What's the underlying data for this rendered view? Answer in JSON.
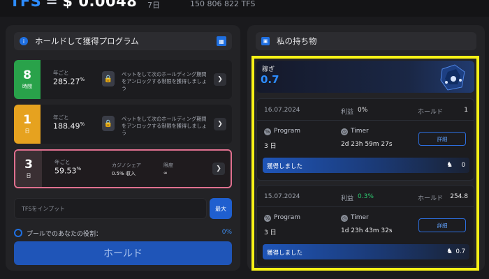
{
  "top": {
    "tfs_label": "TFS",
    "eq": "=",
    "price": "$ 0.0048",
    "period": "7日",
    "supply": "150 806 822 TFS"
  },
  "left": {
    "header_title": "ホールドして獲得プログラム",
    "programs": [
      {
        "duration_num": "8",
        "duration_unit": "時間",
        "per_label": "年ごと",
        "rate": "285.27",
        "rate_unit": "%",
        "lock_text": "ペットをして次のホールディング期間をアンロックする制限を獲得しましょう",
        "badge_color": "#29a24a"
      },
      {
        "duration_num": "1",
        "duration_unit": "日",
        "per_label": "年ごと",
        "rate": "188.49",
        "rate_unit": "%",
        "lock_text": "ペットをして次のホールディング期間をアンロックする制限を獲得しましょう",
        "badge_color": "#e6a21f"
      },
      {
        "duration_num": "3",
        "duration_unit": "日",
        "per_label": "年ごと",
        "rate": "59.53",
        "rate_unit": "%",
        "casino_label": "カジノシェア",
        "casino_value": "0.5% 収入",
        "limit_label": "限度",
        "limit_value": "∞",
        "badge_color": "#3a2f33",
        "border_color": "#e0708f"
      }
    ],
    "input_placeholder": "TFSをインプット",
    "max_label": "最大",
    "share_label": "プールでのあなたの役割：",
    "share_value": "0%",
    "hold_button": "ホールド"
  },
  "right": {
    "header_title": "私の持ち物",
    "earn_title": "稼ぎ",
    "earn_value": "0.7",
    "holdings": [
      {
        "date": "16.07.2024",
        "profit_label": "利益",
        "profit_value": "0%",
        "hold_label": "ホールド",
        "hold_value": "1",
        "program_label": "Program",
        "program_value": "3 日",
        "timer_label": "Timer",
        "timer_value": "2d 23h 59m 27s",
        "detail_label": "詳細",
        "earned_label": "獲得しました",
        "earned_value": "0"
      },
      {
        "date": "15.07.2024",
        "profit_label": "利益",
        "profit_value": "0.3%",
        "hold_label": "ホールド",
        "hold_value": "254.8",
        "program_label": "Program",
        "program_value": "3 日",
        "timer_label": "Timer",
        "timer_value": "1d 23h 43m 32s",
        "detail_label": "詳細",
        "earned_label": "獲得しました",
        "earned_value": "0.7"
      }
    ]
  }
}
